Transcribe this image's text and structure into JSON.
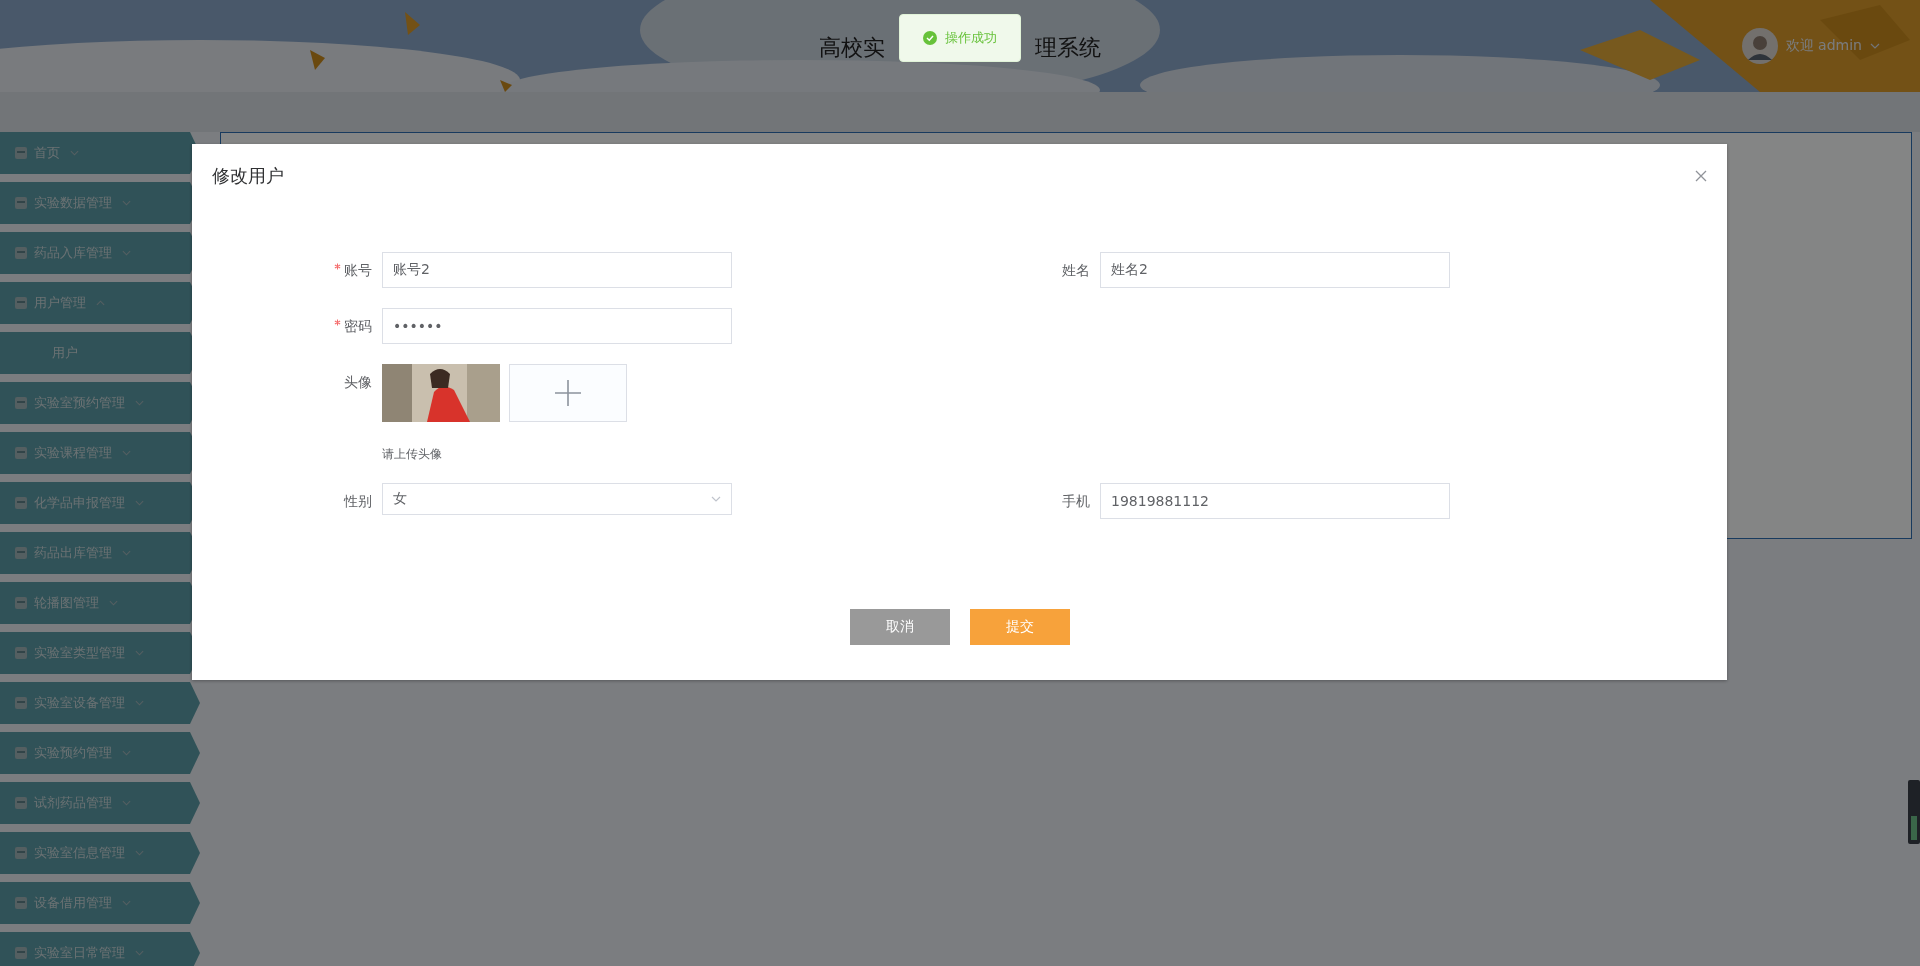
{
  "header": {
    "title_start": "高校实",
    "title_end": "理系统",
    "greeting": "欢迎 admin"
  },
  "toast": {
    "message": "操作成功"
  },
  "sidebar": {
    "items": [
      {
        "label": "首页",
        "expanded": false
      },
      {
        "label": "实验数据管理",
        "expanded": false
      },
      {
        "label": "药品入库管理",
        "expanded": false
      },
      {
        "label": "用户管理",
        "expanded": true,
        "children": [
          {
            "label": "用户"
          }
        ]
      },
      {
        "label": "实验室预约管理",
        "expanded": false
      },
      {
        "label": "实验课程管理",
        "expanded": false
      },
      {
        "label": "化学品申报管理",
        "expanded": false
      },
      {
        "label": "药品出库管理",
        "expanded": false
      },
      {
        "label": "轮播图管理",
        "expanded": false
      },
      {
        "label": "实验室类型管理",
        "expanded": false
      },
      {
        "label": "实验室设备管理",
        "expanded": false
      },
      {
        "label": "实验预约管理",
        "expanded": false
      },
      {
        "label": "试剂药品管理",
        "expanded": false
      },
      {
        "label": "实验室信息管理",
        "expanded": false
      },
      {
        "label": "设备借用管理",
        "expanded": false
      },
      {
        "label": "实验室日常管理",
        "expanded": false
      }
    ]
  },
  "dialog": {
    "title": "修改用户",
    "rows": [
      {
        "cells": [
          {
            "kind": "text",
            "label": "账号",
            "required": true,
            "value": "账号2"
          },
          {
            "kind": "text",
            "label": "姓名",
            "required": false,
            "value": "姓名2"
          }
        ]
      },
      {
        "cells": [
          {
            "kind": "text",
            "label": "密码",
            "required": true,
            "value": "••••••"
          }
        ]
      },
      {
        "cells": [
          {
            "kind": "upload",
            "label": "头像",
            "required": false,
            "hint": "请上传头像"
          }
        ]
      },
      {
        "cells": [
          {
            "kind": "select",
            "label": "性别",
            "required": false,
            "value": "女"
          },
          {
            "kind": "text",
            "label": "手机",
            "required": false,
            "value": "19819881112"
          }
        ]
      }
    ],
    "buttons": [
      {
        "label": "取消",
        "kind": "cancel"
      },
      {
        "label": "提交",
        "kind": "submit"
      }
    ]
  }
}
